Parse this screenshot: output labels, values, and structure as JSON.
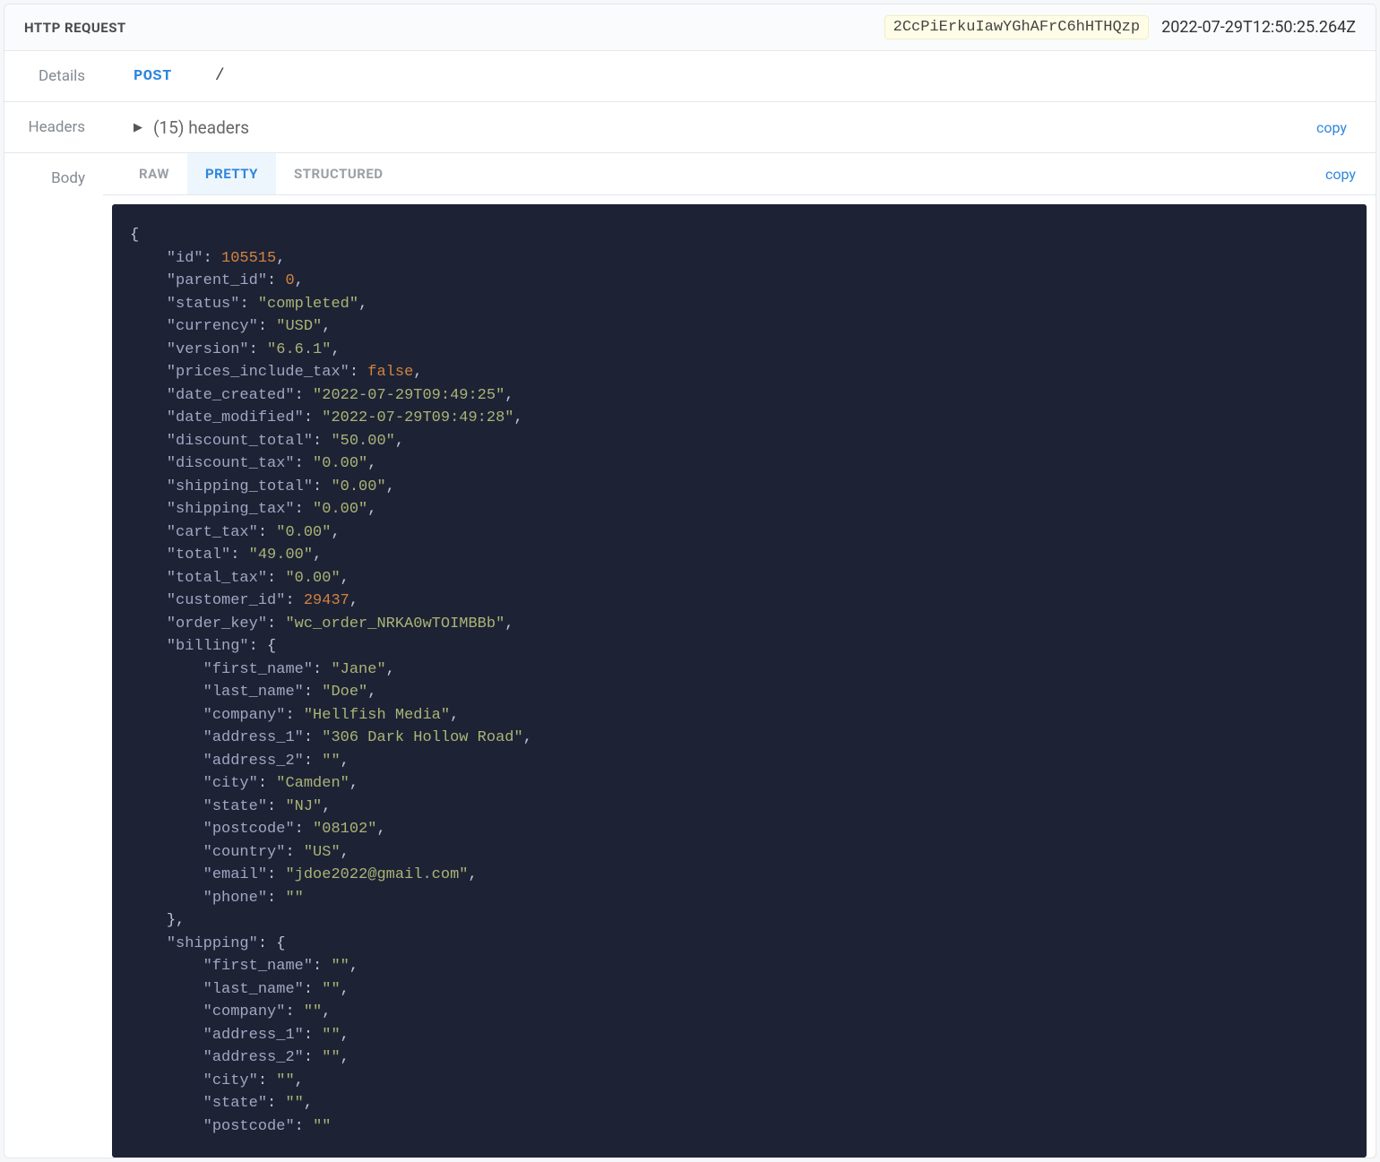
{
  "header": {
    "title": "HTTP REQUEST",
    "badge": "2CcPiErkuIawYGhAFrC6hHTHQzp",
    "timestamp": "2022-07-29T12:50:25.264Z"
  },
  "details": {
    "label": "Details",
    "method": "POST",
    "path": "/"
  },
  "headers": {
    "label": "Headers",
    "summary": "(15) headers",
    "copy": "copy"
  },
  "body": {
    "label": "Body",
    "tabs": {
      "raw": "RAW",
      "pretty": "PRETTY",
      "structured": "STRUCTURED"
    },
    "copy": "copy"
  },
  "json": {
    "id": 105515,
    "parent_id": 0,
    "status": "completed",
    "currency": "USD",
    "version": "6.6.1",
    "prices_include_tax": false,
    "date_created": "2022-07-29T09:49:25",
    "date_modified": "2022-07-29T09:49:28",
    "discount_total": "50.00",
    "discount_tax": "0.00",
    "shipping_total": "0.00",
    "shipping_tax": "0.00",
    "cart_tax": "0.00",
    "total": "49.00",
    "total_tax": "0.00",
    "customer_id": 29437,
    "order_key": "wc_order_NRKA0wTOIMBBb",
    "billing": {
      "first_name": "Jane",
      "last_name": "Doe",
      "company": "Hellfish Media",
      "address_1": "306 Dark Hollow Road",
      "address_2": "",
      "city": "Camden",
      "state": "NJ",
      "postcode": "08102",
      "country": "US",
      "email": "jdoe2022@gmail.com",
      "phone": ""
    },
    "shipping": {
      "first_name": "",
      "last_name": "",
      "company": "",
      "address_1": "",
      "address_2": "",
      "city": "",
      "state": "",
      "postcode": ""
    }
  }
}
